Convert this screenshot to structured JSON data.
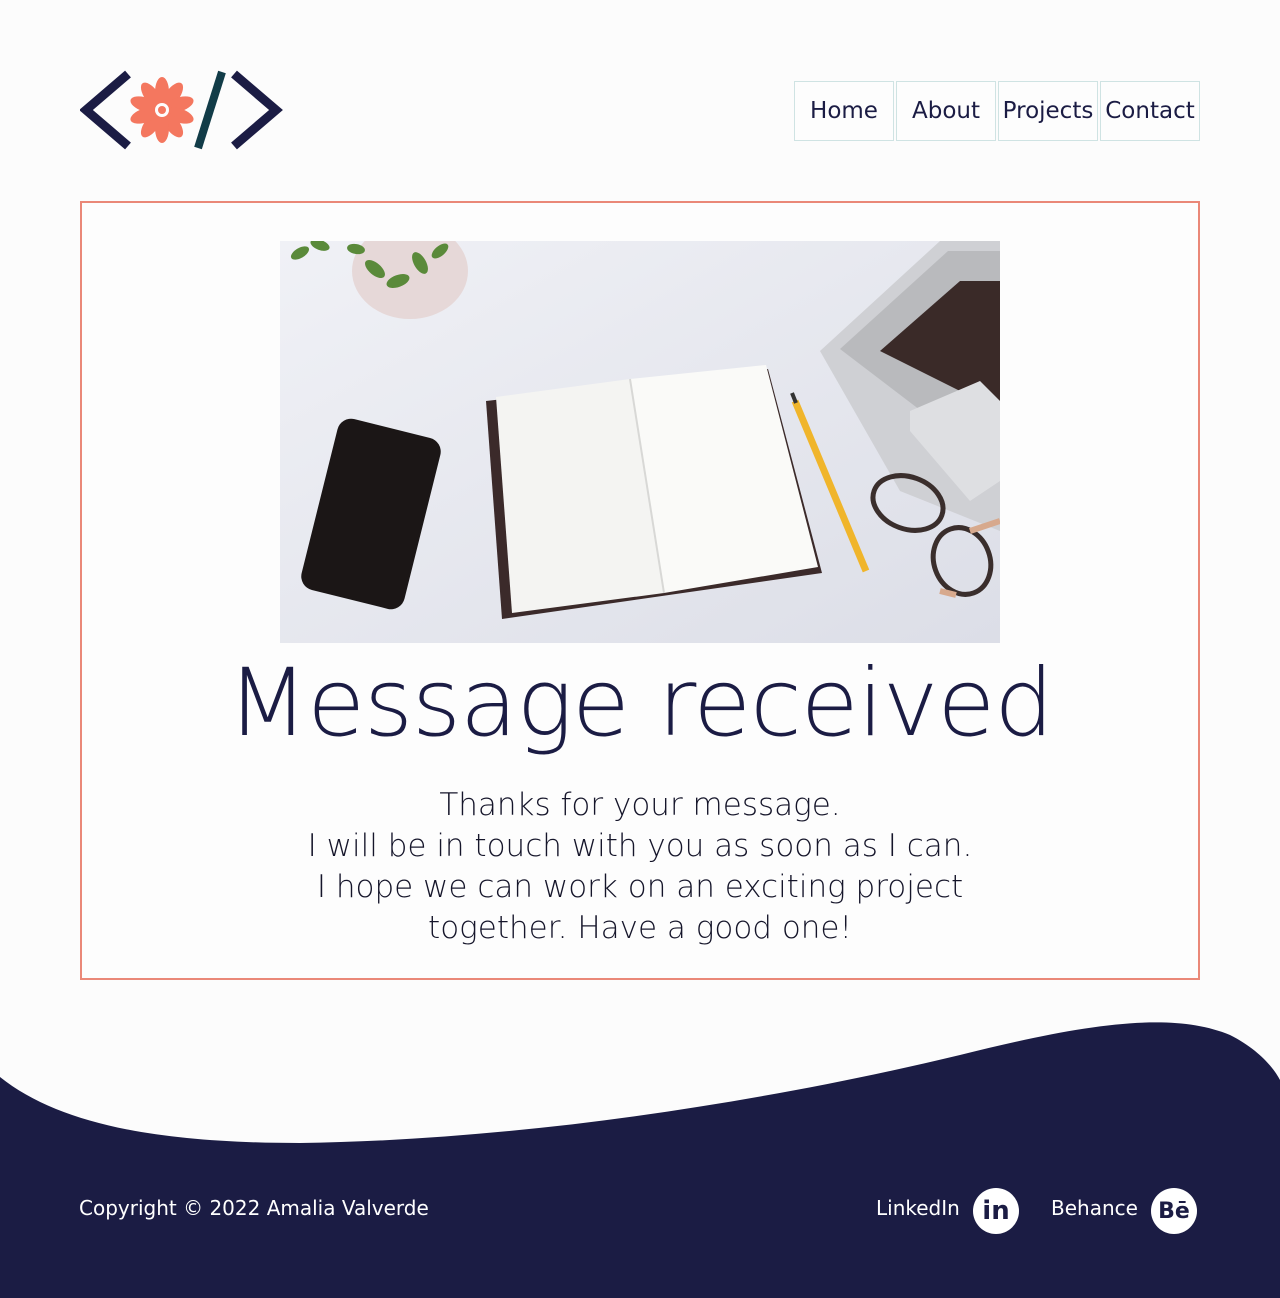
{
  "brand": {
    "logo_icon": "code-brackets-flower-logo",
    "accent_color": "#f4775f",
    "navy_color": "#1b1c44"
  },
  "nav": {
    "items": [
      {
        "label": "Home"
      },
      {
        "label": "About"
      },
      {
        "label": "Projects"
      },
      {
        "label": "Contact"
      }
    ]
  },
  "main": {
    "hero_image": "desk-with-notebook-phone-laptop-glasses-pencil",
    "headline": "Message received",
    "message_lines": [
      "Thanks for your message.",
      "I will be in touch with you as soon as I can.",
      "I hope we can work on an exciting project",
      "together. Have a good one!"
    ],
    "card_border_color": "#ea8878"
  },
  "footer": {
    "copyright": "Copyright © 2022 Amalia Valverde",
    "linkedin_label": "LinkedIn",
    "linkedin_icon_text": "in",
    "behance_label": "Behance",
    "behance_icon_text": "Bē",
    "background_color": "#1b1c44"
  }
}
